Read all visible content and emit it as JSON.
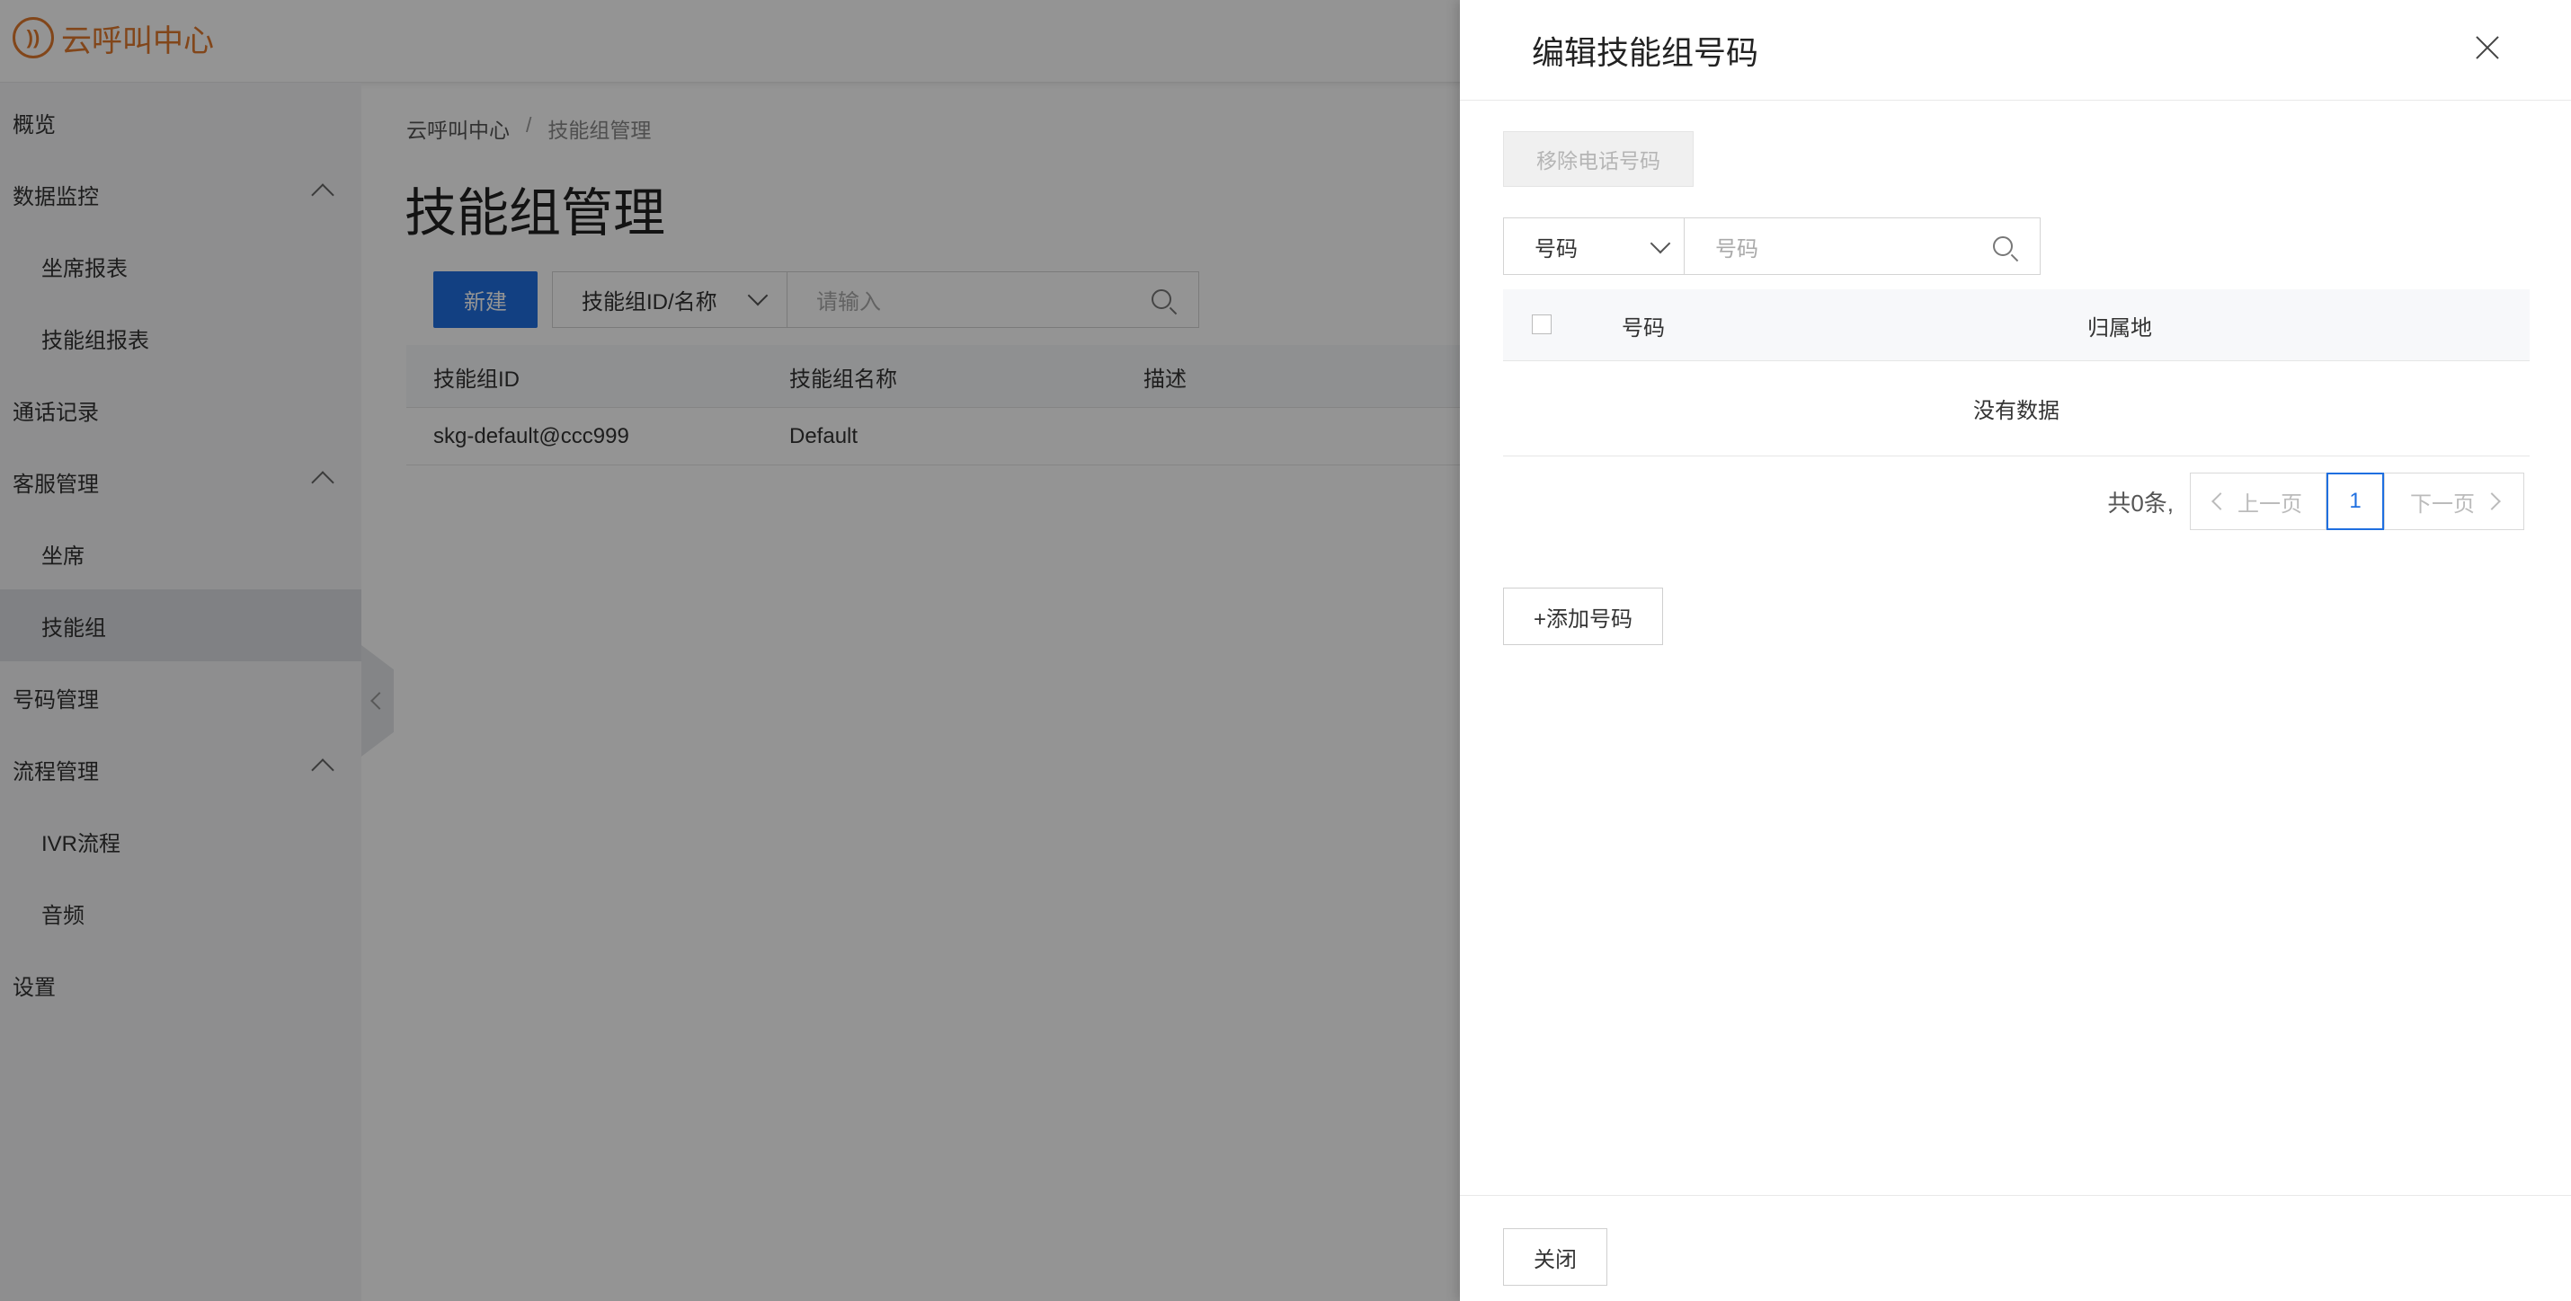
{
  "app": {
    "logo_text": "云呼叫中心",
    "brand_color": "#e0792d",
    "accent_color": "#1f6fe0"
  },
  "sidebar": {
    "items": [
      {
        "label": "概览"
      },
      {
        "label": "数据监控"
      },
      {
        "label": "坐席报表"
      },
      {
        "label": "技能组报表"
      },
      {
        "label": "通话记录"
      },
      {
        "label": "客服管理"
      },
      {
        "label": "坐席"
      },
      {
        "label": "技能组"
      },
      {
        "label": "号码管理"
      },
      {
        "label": "流程管理"
      },
      {
        "label": "IVR流程"
      },
      {
        "label": "音频"
      },
      {
        "label": "设置"
      }
    ]
  },
  "breadcrumb": {
    "root": "云呼叫中心",
    "separator": "/",
    "current": "技能组管理"
  },
  "page": {
    "title": "技能组管理"
  },
  "toolbar": {
    "new_label": "新建",
    "filter_select": "技能组ID/名称",
    "search_placeholder": "请输入"
  },
  "table": {
    "columns": [
      "技能组ID",
      "技能组名称",
      "描述"
    ],
    "rows": [
      [
        "skg-default@ccc999",
        "Default",
        ""
      ]
    ]
  },
  "drawer": {
    "title": "编辑技能组号码",
    "remove_label": "移除电话号码",
    "filter_select": "号码",
    "search_placeholder": "号码",
    "columns": [
      "号码",
      "归属地"
    ],
    "empty_text": "没有数据",
    "total_text": "共0条,",
    "prev_label": "上一页",
    "page_number": "1",
    "next_label": "下一页",
    "add_label": "+添加号码",
    "close_label": "关闭"
  }
}
